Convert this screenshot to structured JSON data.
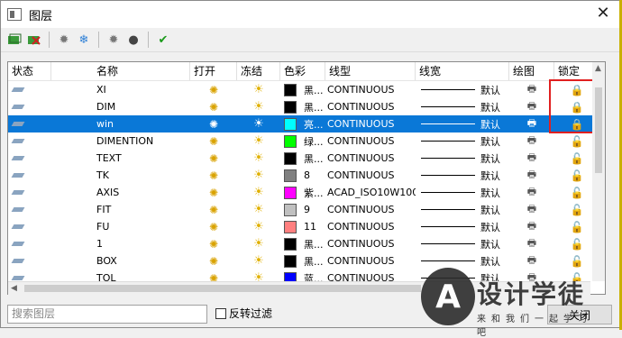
{
  "window": {
    "title": "图层"
  },
  "toolbar": {
    "icons": [
      "new-layer-icon",
      "delete-layer-icon",
      "freeze-icon",
      "snowflake-icon",
      "isolate-icon",
      "bulb-icon",
      "checkmark-icon"
    ]
  },
  "table": {
    "headers": {
      "state": "状态",
      "name": "名称",
      "open": "打开",
      "freeze": "冻结",
      "color": "色彩",
      "linetype": "线型",
      "lineweight": "线宽",
      "plot": "绘图",
      "lock": "锁定"
    },
    "rows": [
      {
        "name": "XI",
        "color_hex": "#000000",
        "color_name": "黑...",
        "linetype": "CONTINUOUS",
        "lineweight": "默认",
        "selected": false,
        "locked": true
      },
      {
        "name": "DIM",
        "color_hex": "#000000",
        "color_name": "黑...",
        "linetype": "CONTINUOUS",
        "lineweight": "默认",
        "selected": false,
        "locked": true
      },
      {
        "name": "win",
        "color_hex": "#00ffff",
        "color_name": "亮...",
        "linetype": "CONTINUOUS",
        "lineweight": "默认",
        "selected": true,
        "locked": true
      },
      {
        "name": "DIMENTION",
        "color_hex": "#00ff00",
        "color_name": "绿...",
        "linetype": "CONTINUOUS",
        "lineweight": "默认",
        "selected": false,
        "locked": false
      },
      {
        "name": "TEXT",
        "color_hex": "#000000",
        "color_name": "黑...",
        "linetype": "CONTINUOUS",
        "lineweight": "默认",
        "selected": false,
        "locked": false
      },
      {
        "name": "TK",
        "color_hex": "#808080",
        "color_name": "8",
        "linetype": "CONTINUOUS",
        "lineweight": "默认",
        "selected": false,
        "locked": false
      },
      {
        "name": "AXIS",
        "color_hex": "#ff00ff",
        "color_name": "紫...",
        "linetype": "ACAD_ISO10W100",
        "lineweight": "默认",
        "selected": false,
        "locked": false
      },
      {
        "name": "FIT",
        "color_hex": "#c0c0c0",
        "color_name": "9",
        "linetype": "CONTINUOUS",
        "lineweight": "默认",
        "selected": false,
        "locked": false
      },
      {
        "name": "FU",
        "color_hex": "#ff7f7f",
        "color_name": "11",
        "linetype": "CONTINUOUS",
        "lineweight": "默认",
        "selected": false,
        "locked": false
      },
      {
        "name": "1",
        "color_hex": "#000000",
        "color_name": "黑...",
        "linetype": "CONTINUOUS",
        "lineweight": "默认",
        "selected": false,
        "locked": false
      },
      {
        "name": "BOX",
        "color_hex": "#000000",
        "color_name": "黑...",
        "linetype": "CONTINUOUS",
        "lineweight": "默认",
        "selected": false,
        "locked": false
      },
      {
        "name": "TOL",
        "color_hex": "#0000ff",
        "color_name": "蓝...",
        "linetype": "CONTINUOUS",
        "lineweight": "默认",
        "selected": false,
        "locked": false
      }
    ]
  },
  "footer": {
    "search_placeholder": "搜索图层",
    "invert_filter_label": "反转过滤",
    "close_label": "关闭"
  },
  "watermark": {
    "brand": "设计学徒",
    "slogan": "来和我们一起学习吧"
  },
  "colors": {
    "selection": "#0a78d7",
    "highlight": "#e02020"
  }
}
